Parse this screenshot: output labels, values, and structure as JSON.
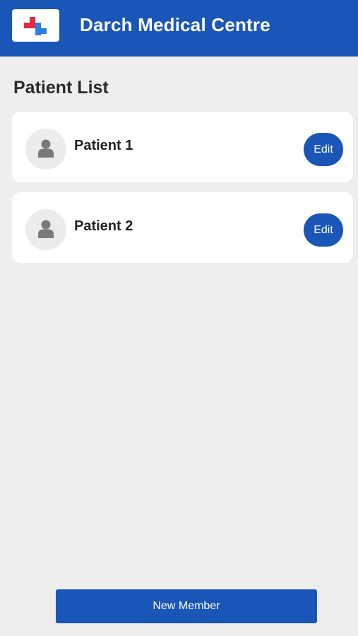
{
  "header": {
    "title": "Darch Medical Centre",
    "logo_icon": "medical-cross-logo-icon",
    "background_color": "#1a56b8"
  },
  "page": {
    "title": "Patient List"
  },
  "patients": [
    {
      "name": "Patient 1",
      "edit_label": "Edit",
      "avatar_icon": "person-icon"
    },
    {
      "name": "Patient 2",
      "edit_label": "Edit",
      "avatar_icon": "person-icon"
    }
  ],
  "footer": {
    "new_member_label": "New Member"
  },
  "colors": {
    "accent": "#1a56b8",
    "logo_red": "#e52b3d",
    "logo_blue": "#2a7de1",
    "background": "#eeeeee",
    "card": "#ffffff"
  }
}
